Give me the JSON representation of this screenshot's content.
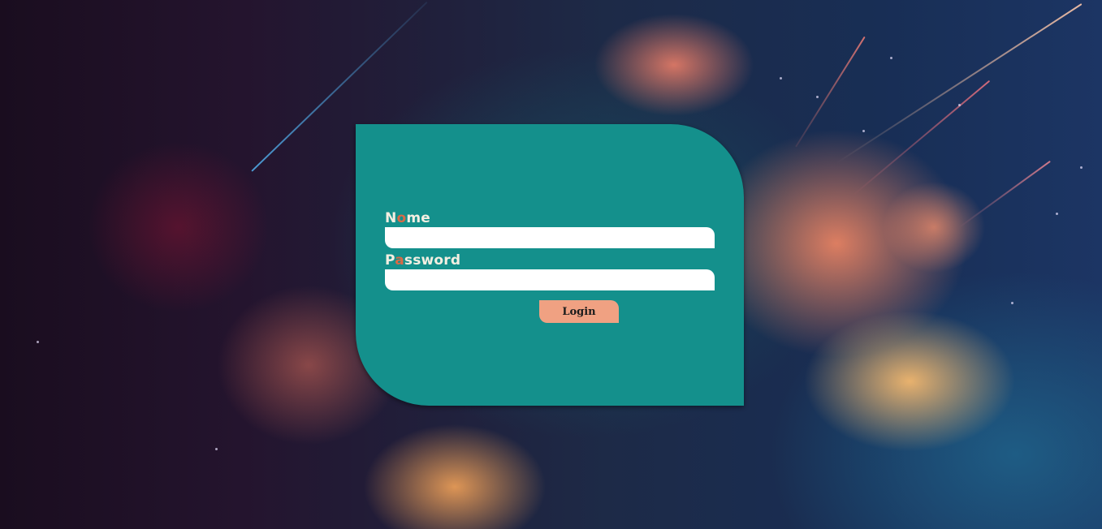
{
  "login_form": {
    "name_label": {
      "first": "N",
      "accent": "o",
      "rest": "me"
    },
    "name_value": "",
    "password_label": {
      "first": "P",
      "accent": "a",
      "rest": "ssword"
    },
    "password_value": "",
    "login_button_label": "Login"
  },
  "colors": {
    "card_background": "#14908c",
    "label_text": "#f4efe2",
    "label_accent": "#d86a47",
    "input_background": "#ffffff",
    "button_background": "#f0a182"
  }
}
